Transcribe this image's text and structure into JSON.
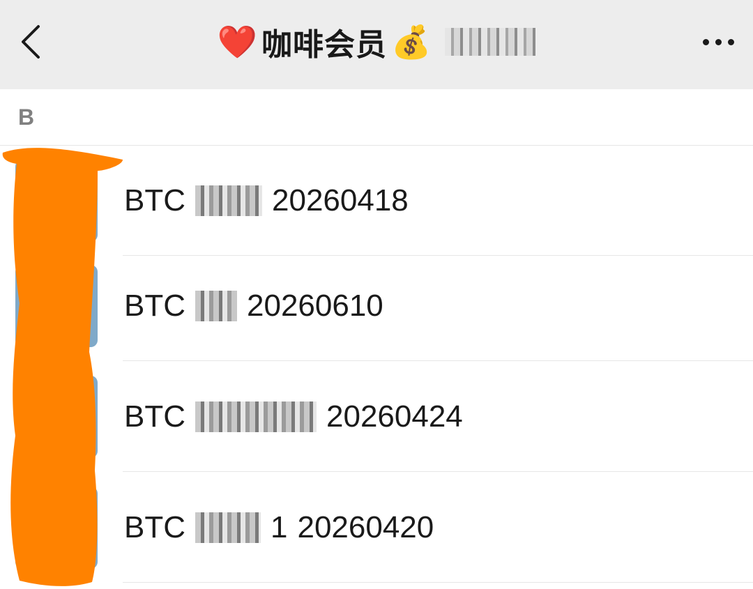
{
  "nav": {
    "back_icon": "chevron-left-icon",
    "title_heart": "❤️",
    "title": "咖啡会员",
    "title_bag": "💰",
    "more_icon": "more-horizontal-icon"
  },
  "section": {
    "letter": "B"
  },
  "rows": [
    {
      "prefix": "BTC",
      "date": "20260418"
    },
    {
      "prefix": "BTC",
      "date": "20260610"
    },
    {
      "prefix": "BTC",
      "date": "20260424"
    },
    {
      "prefix": "BTC",
      "suffix": "1",
      "date": "20260420"
    }
  ],
  "colors": {
    "nav_bg": "#ededed",
    "redaction_orange": "#ff8200",
    "text": "#1a1a1a",
    "section_text": "#808080"
  }
}
